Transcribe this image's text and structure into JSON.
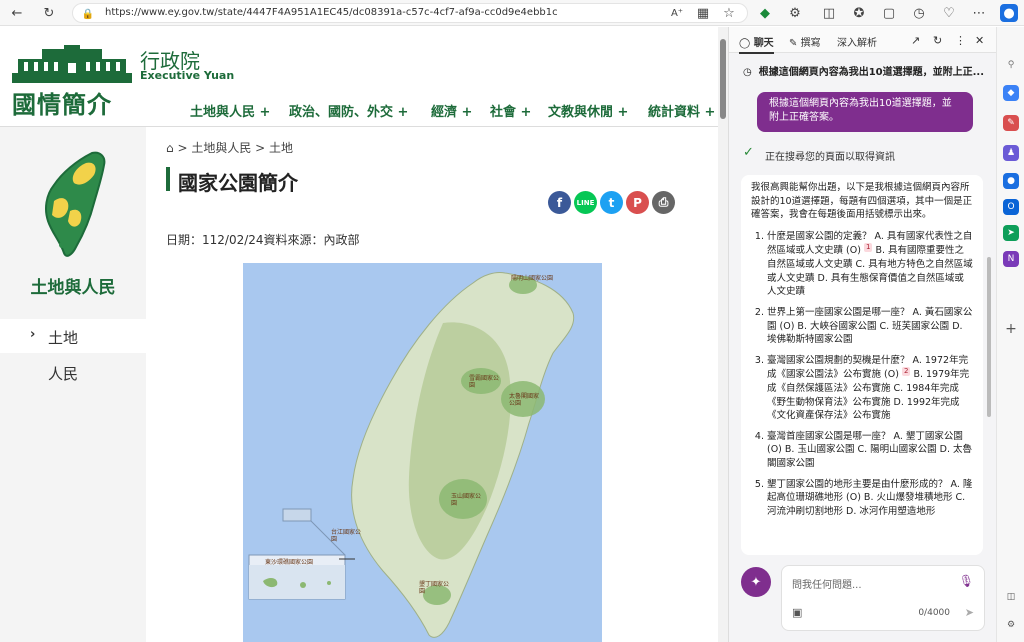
{
  "browser": {
    "url": "https://www.ey.gov.tw/state/4447F4A951A1EC45/dc08391a-c57c-4cf7-af9a-cc0d9e4ebb1c"
  },
  "site": {
    "logo_title": "國情簡介",
    "ey_cn": "行政院",
    "ey_en": "Executive Yuan",
    "nav": [
      "土地與人民 +",
      "政治、國防、外交 +",
      "經濟 +",
      "社會 +",
      "文教與休閒 +",
      "統計資料 +"
    ]
  },
  "sidebar": {
    "title": "土地與人民",
    "items": [
      {
        "label": "土地",
        "active": true
      },
      {
        "label": "人民",
        "active": false
      }
    ]
  },
  "content": {
    "breadcrumb": [
      "土地與人民",
      "土地"
    ],
    "title": "國家公園簡介",
    "meta": "日期：112/02/24資料來源：內政部",
    "share_icons": [
      "facebook-icon",
      "line-icon",
      "twitter-icon",
      "plurk-icon",
      "print-icon"
    ],
    "map_labels": [
      "陽明山國家公園",
      "雪霸國家公園",
      "太魯閣國家公園",
      "玉山國家公園",
      "台江國家公園",
      "墾丁國家公園",
      "東沙環礁國家公園"
    ]
  },
  "copilot": {
    "tabs": [
      "聊天",
      "撰寫",
      "深入解析"
    ],
    "prompt": "根據這個網頁內容為我出10道選擇題，並附上正...",
    "user_message": "根據這個網頁內容為我出10道選擇題，並附上正確答案。",
    "search_status": "正在搜尋您的頁面以取得資訊",
    "response_intro": "我很高興能幫你出題，以下是我根據這個網頁內容所設計的10道選擇題，每題有四個選項，其中一個是正確答案，我會在每題後面用括號標示出來。",
    "questions": [
      {
        "text": "什麼是國家公園的定義？ A. 具有國家代表性之自然區域或人文史蹟 (O)",
        "cite": "1",
        "rest": " B. 具有國際重要性之自然區域或人文史蹟 C. 具有地方特色之自然區域或人文史蹟 D. 具有生態保育價值之自然區域或人文史蹟"
      },
      {
        "text": "世界上第一座國家公園是哪一座？ A. 黃石國家公園 (O) B. 大峽谷國家公園 C. 班芙國家公園 D. 埃佛勒斯特國家公園",
        "cite": "",
        "rest": ""
      },
      {
        "text": "臺灣國家公園規劃的契機是什麼？ A. 1972年完成《國家公園法》公布實施 (O)",
        "cite": "2",
        "rest": " B. 1979年完成《自然保護區法》公布實施 C. 1984年完成《野生動物保育法》公布實施 D. 1992年完成《文化資產保存法》公布實施"
      },
      {
        "text": "臺灣首座國家公園是哪一座？ A. 墾丁國家公園 (O) B. 玉山國家公園 C. 陽明山國家公園 D. 太魯閣國家公園",
        "cite": "",
        "rest": ""
      },
      {
        "text": "墾丁國家公園的地形主要是由什麼形成的？ A. 隆起高位珊瑚礁地形 (O) B. 火山爆發堆積地形 C. 河流沖刷切割地形 D. 冰河作用塑造地形",
        "cite": "",
        "rest": ""
      }
    ],
    "input_placeholder": "問我任何問題...",
    "counter": "0/4000"
  }
}
